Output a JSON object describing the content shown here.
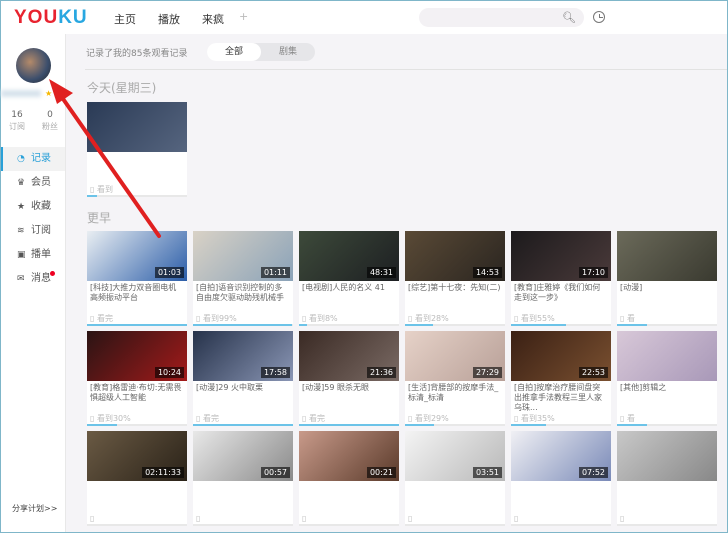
{
  "header": {
    "logo_you": "YOU",
    "logo_ku": "KU",
    "nav": [
      "主页",
      "播放",
      "来疯"
    ],
    "plus": "+"
  },
  "sidebar": {
    "stats": [
      {
        "value": "16",
        "label": "订阅"
      },
      {
        "value": "0",
        "label": "粉丝"
      }
    ],
    "items": [
      {
        "label": "记录",
        "icon": "◔"
      },
      {
        "label": "会员",
        "icon": "♛"
      },
      {
        "label": "收藏",
        "icon": "★"
      },
      {
        "label": "订阅",
        "icon": "≋"
      },
      {
        "label": "播单",
        "icon": "▣"
      },
      {
        "label": "消息",
        "icon": "✉"
      }
    ],
    "share": "分享计划>>"
  },
  "main": {
    "record_text": "记录了我的85条观看记录",
    "tabs": [
      "全部",
      "剧集"
    ],
    "today": "今天(星期三)",
    "earlier": "更早",
    "today_cards": [
      {
        "title": "",
        "progress_text": "看到",
        "progress": 0.1,
        "colors": [
          "#2a3a55",
          "#56657f"
        ]
      }
    ],
    "earlier_cards": [
      {
        "title": "[科技]大推力双音圈电机高频振动平台",
        "duration": "01:03",
        "progress_text": "看完",
        "progress": 1,
        "colors": [
          "#e9eef2",
          "#2b5da8"
        ]
      },
      {
        "title": "[自拍]语音识别控制的多自由度欠驱动助残机械手",
        "duration": "01:11",
        "progress_text": "看到99%",
        "progress": 0.99,
        "colors": [
          "#d9d2c6",
          "#8aa2b8"
        ]
      },
      {
        "title": "[电视剧]人民的名义 41",
        "duration": "48:31",
        "progress_text": "看到8%",
        "progress": 0.08,
        "colors": [
          "#3d4a3a",
          "#1d1f22"
        ]
      },
      {
        "title": "[综艺]第十七夜：先知(二)",
        "duration": "14:53",
        "progress_text": "看到28%",
        "progress": 0.28,
        "colors": [
          "#5a4a36",
          "#2a2520"
        ]
      },
      {
        "title": "[教育]庄雅婷《我们如何走到这一步》",
        "duration": "17:10",
        "progress_text": "看到55%",
        "progress": 0.55,
        "colors": [
          "#1c1a1c",
          "#4a3a3a"
        ]
      },
      {
        "title": "[动漫]",
        "duration": "",
        "progress_text": "看",
        "progress": 0.3,
        "colors": [
          "#6b6a5a",
          "#3a3a30"
        ]
      },
      {
        "title": "[教育]格雷迪·布切:无需畏惧超级人工智能",
        "duration": "10:24",
        "progress_text": "看到30%",
        "progress": 0.3,
        "colors": [
          "#2a1414",
          "#a31a1a"
        ]
      },
      {
        "title": "[动漫]29 火中取栗",
        "duration": "17:58",
        "progress_text": "看完",
        "progress": 1,
        "colors": [
          "#26324a",
          "#8a96b5"
        ]
      },
      {
        "title": "[动漫]59 眼杀无眼",
        "duration": "21:36",
        "progress_text": "看完",
        "progress": 1,
        "colors": [
          "#3a2a24",
          "#7a6a64"
        ]
      },
      {
        "title": "[生活]背腰部的按摩手法_标清_标清",
        "duration": "27:29",
        "progress_text": "看到29%",
        "progress": 0.29,
        "colors": [
          "#e6d2c8",
          "#b8a098"
        ]
      },
      {
        "title": "[自拍]按摩治疗腰间盘突出推拿手法教程三里人家乌珠...",
        "duration": "22:53",
        "progress_text": "看到35%",
        "progress": 0.35,
        "colors": [
          "#3a2014",
          "#7a5030"
        ]
      },
      {
        "title": "[其他]剪辑之",
        "duration": "",
        "progress_text": "看",
        "progress": 0.3,
        "colors": [
          "#d8c8d8",
          "#a898b8"
        ]
      },
      {
        "title": "",
        "duration": "02:11:33",
        "progress_text": "",
        "progress": 0,
        "colors": [
          "#6a5a44",
          "#2a2218"
        ]
      },
      {
        "title": "",
        "duration": "00:57",
        "progress_text": "",
        "progress": 0,
        "colors": [
          "#e8e8e8",
          "#8a8a8a"
        ]
      },
      {
        "title": "",
        "duration": "00:21",
        "progress_text": "",
        "progress": 0,
        "colors": [
          "#c89a8a",
          "#5a3a2a"
        ]
      },
      {
        "title": "",
        "duration": "03:51",
        "progress_text": "",
        "progress": 0,
        "colors": [
          "#f4f4f4",
          "#b8b8b8"
        ]
      },
      {
        "title": "",
        "duration": "07:52",
        "progress_text": "",
        "progress": 0,
        "colors": [
          "#f0f0f4",
          "#7a8ab8"
        ]
      },
      {
        "title": "",
        "duration": "",
        "progress_text": "",
        "progress": 0,
        "colors": [
          "#c8c8c8",
          "#888"
        ]
      }
    ]
  }
}
